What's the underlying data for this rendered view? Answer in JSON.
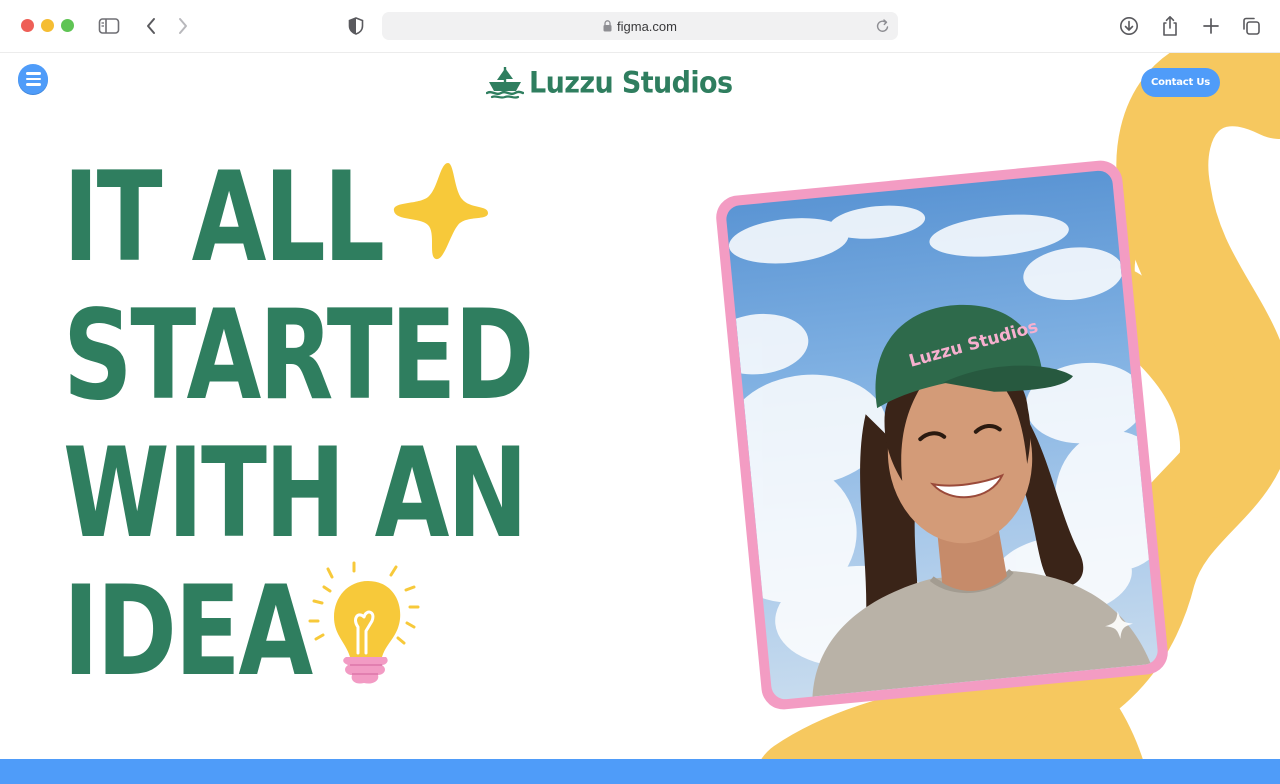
{
  "browser": {
    "url": "figma.com"
  },
  "header": {
    "brand": "Luzzu Studios",
    "contact_label": "Contact Us"
  },
  "hero": {
    "headline_lines": [
      "IT ALL",
      "STARTED",
      "WITH AN",
      "IDEA"
    ],
    "photo_cap_text": "Luzzu Studios"
  },
  "icons": {
    "menu": "hamburger-menu-icon",
    "logo_mark": "boat-logo-icon",
    "sparkle": "four-point-star-icon",
    "bulb": "lightbulb-icon"
  },
  "colors": {
    "brand_green": "#2f7e5f",
    "accent_blue": "#4f9cf9",
    "accent_yellow": "#f6c85f",
    "frame_pink": "#f39cc3"
  }
}
